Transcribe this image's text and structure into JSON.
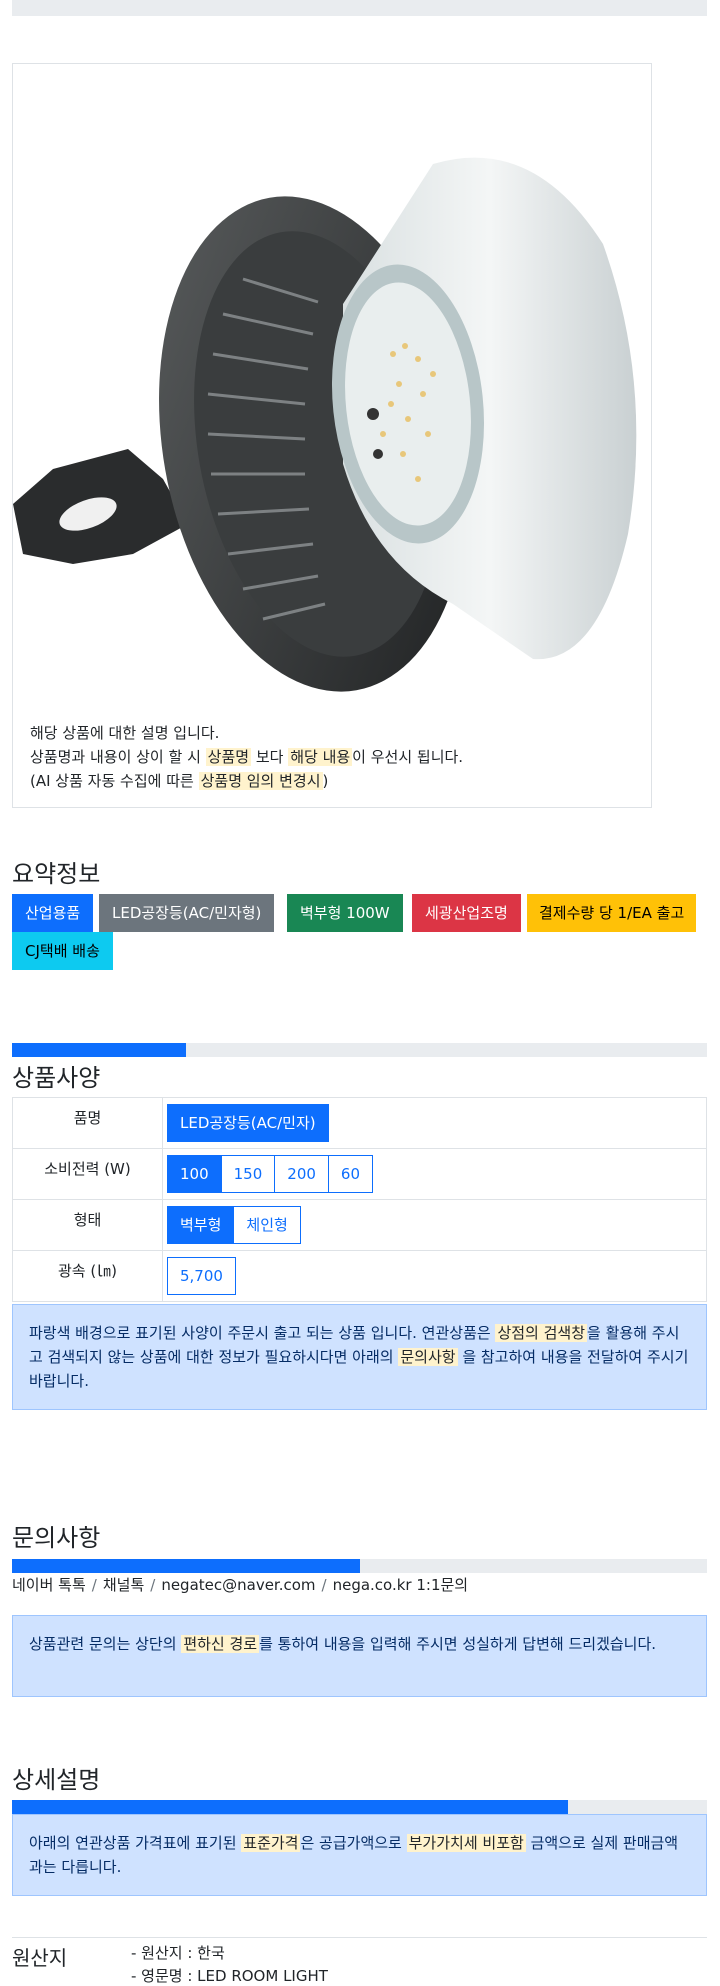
{
  "colors": {
    "primary": "#0d6efd",
    "secondary": "#6c757d",
    "success": "#198754",
    "danger": "#dc3545",
    "warning": "#ffc107",
    "info": "#0dcaf0",
    "alert_bg": "#cfe2ff",
    "highlight": "#fff3cd"
  },
  "product_image": {
    "alt": "LED 공장등 벽부형 100W",
    "note": {
      "line1": "해당 상품에 대한 설명 입니다.",
      "line2_a": "상품명과 내용이 상이 할 시 ",
      "line2_mark1": "상품명",
      "line2_b": " 보다 ",
      "line2_mark2": "해당 내용",
      "line2_c": "이 우선시 됩니다.",
      "line3_a": "(AI 상품 자동 수집에 따른 ",
      "line3_mark": "상품명 임의 변경시",
      "line3_b": ")"
    }
  },
  "summary": {
    "title": "요약정보",
    "badges": [
      {
        "label": "산업용품",
        "color": "primary"
      },
      {
        "label": "LED공장등(AC/민자형)",
        "color": "secondary"
      },
      {
        "label": "벽부형 100W",
        "color": "success"
      },
      {
        "label": "세광산업조명",
        "color": "danger"
      },
      {
        "label": "결제수량 당 1/EA 출고",
        "color": "warning"
      },
      {
        "label": "CJ택배 배송",
        "color": "info"
      }
    ]
  },
  "spec": {
    "title": "상품사양",
    "progress": 0.25,
    "rows": [
      {
        "label": "품명",
        "options": [
          "LED공장등(AC/민자)"
        ],
        "selected": 0
      },
      {
        "label": "소비전력 (W)",
        "options": [
          "100",
          "150",
          "200",
          "60"
        ],
        "selected": 0
      },
      {
        "label": "형태",
        "options": [
          "벽부형",
          "체인형"
        ],
        "selected": 0
      },
      {
        "label": "광속 (㏐)",
        "options": [
          "5,700"
        ],
        "selected": -1
      }
    ],
    "notice": {
      "a": "파랑색 배경으로 표기된 사양이 주문시 출고 되는 상품 입니다. 연관상품은 ",
      "mark1": "상점의 검색창",
      "b": "을 활용해 주시고 검색되지 않는 상품에 대한 정보가 필요하시다면 아래의 ",
      "mark2": "문의사항",
      "c": " 을 참고하여 내용을 전달하여 주시기 바랍니다."
    }
  },
  "inquiry": {
    "title": "문의사항",
    "progress": 0.5,
    "links": [
      "네이버 톡톡",
      "채널톡",
      "negatec@naver.com",
      "nega.co.kr 1:1문의"
    ],
    "notice": {
      "a": "상품관련 문의는 상단의 ",
      "mark": "편하신 경로",
      "b": "를 통하여 내용을 입력해 주시면 성실하게 답변해 드리겠습니다."
    }
  },
  "detail": {
    "title": "상세설명",
    "progress": 0.8,
    "notice": {
      "a": "아래의 연관상품 가격표에 표기된 ",
      "mark1": "표준가격",
      "b": "은 공급가액으로 ",
      "mark2": "부가가치세 비포함",
      "c": " 금액으로 실제 판매금액과는 다릅니다."
    }
  },
  "origin": {
    "label": "원산지",
    "lines": [
      "- 원산지 : 한국",
      "- 영문명 : LED ROOM LIGHT"
    ]
  }
}
